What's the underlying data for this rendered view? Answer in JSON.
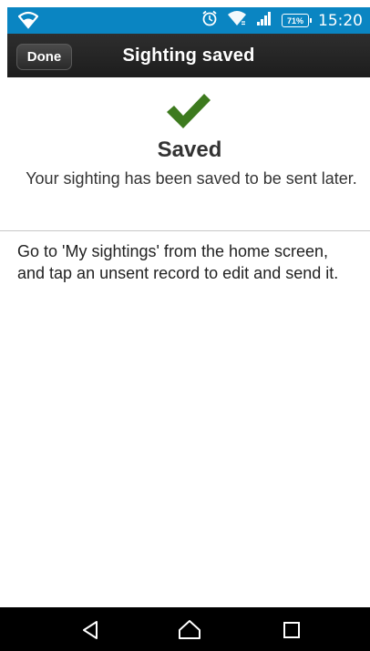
{
  "status_bar": {
    "time": "15:20",
    "battery_percent": "71%",
    "icons": [
      "wifi-icon",
      "alarm-icon",
      "wifi-signal-icon",
      "cell-signal-icon",
      "battery-icon"
    ],
    "background_color": "#0a85c2"
  },
  "header": {
    "done_label": "Done",
    "title": "Sighting saved"
  },
  "confirmation": {
    "icon": "checkmark-icon",
    "icon_color": "#3d7a1e",
    "title": "Saved",
    "message": "Your sighting has been saved to be sent later."
  },
  "instructions": {
    "text": "Go to 'My sightings' from the home screen, and tap an unsent record to edit and send it."
  },
  "nav_bar": {
    "buttons": [
      "back-icon",
      "home-icon",
      "recent-apps-icon"
    ]
  }
}
